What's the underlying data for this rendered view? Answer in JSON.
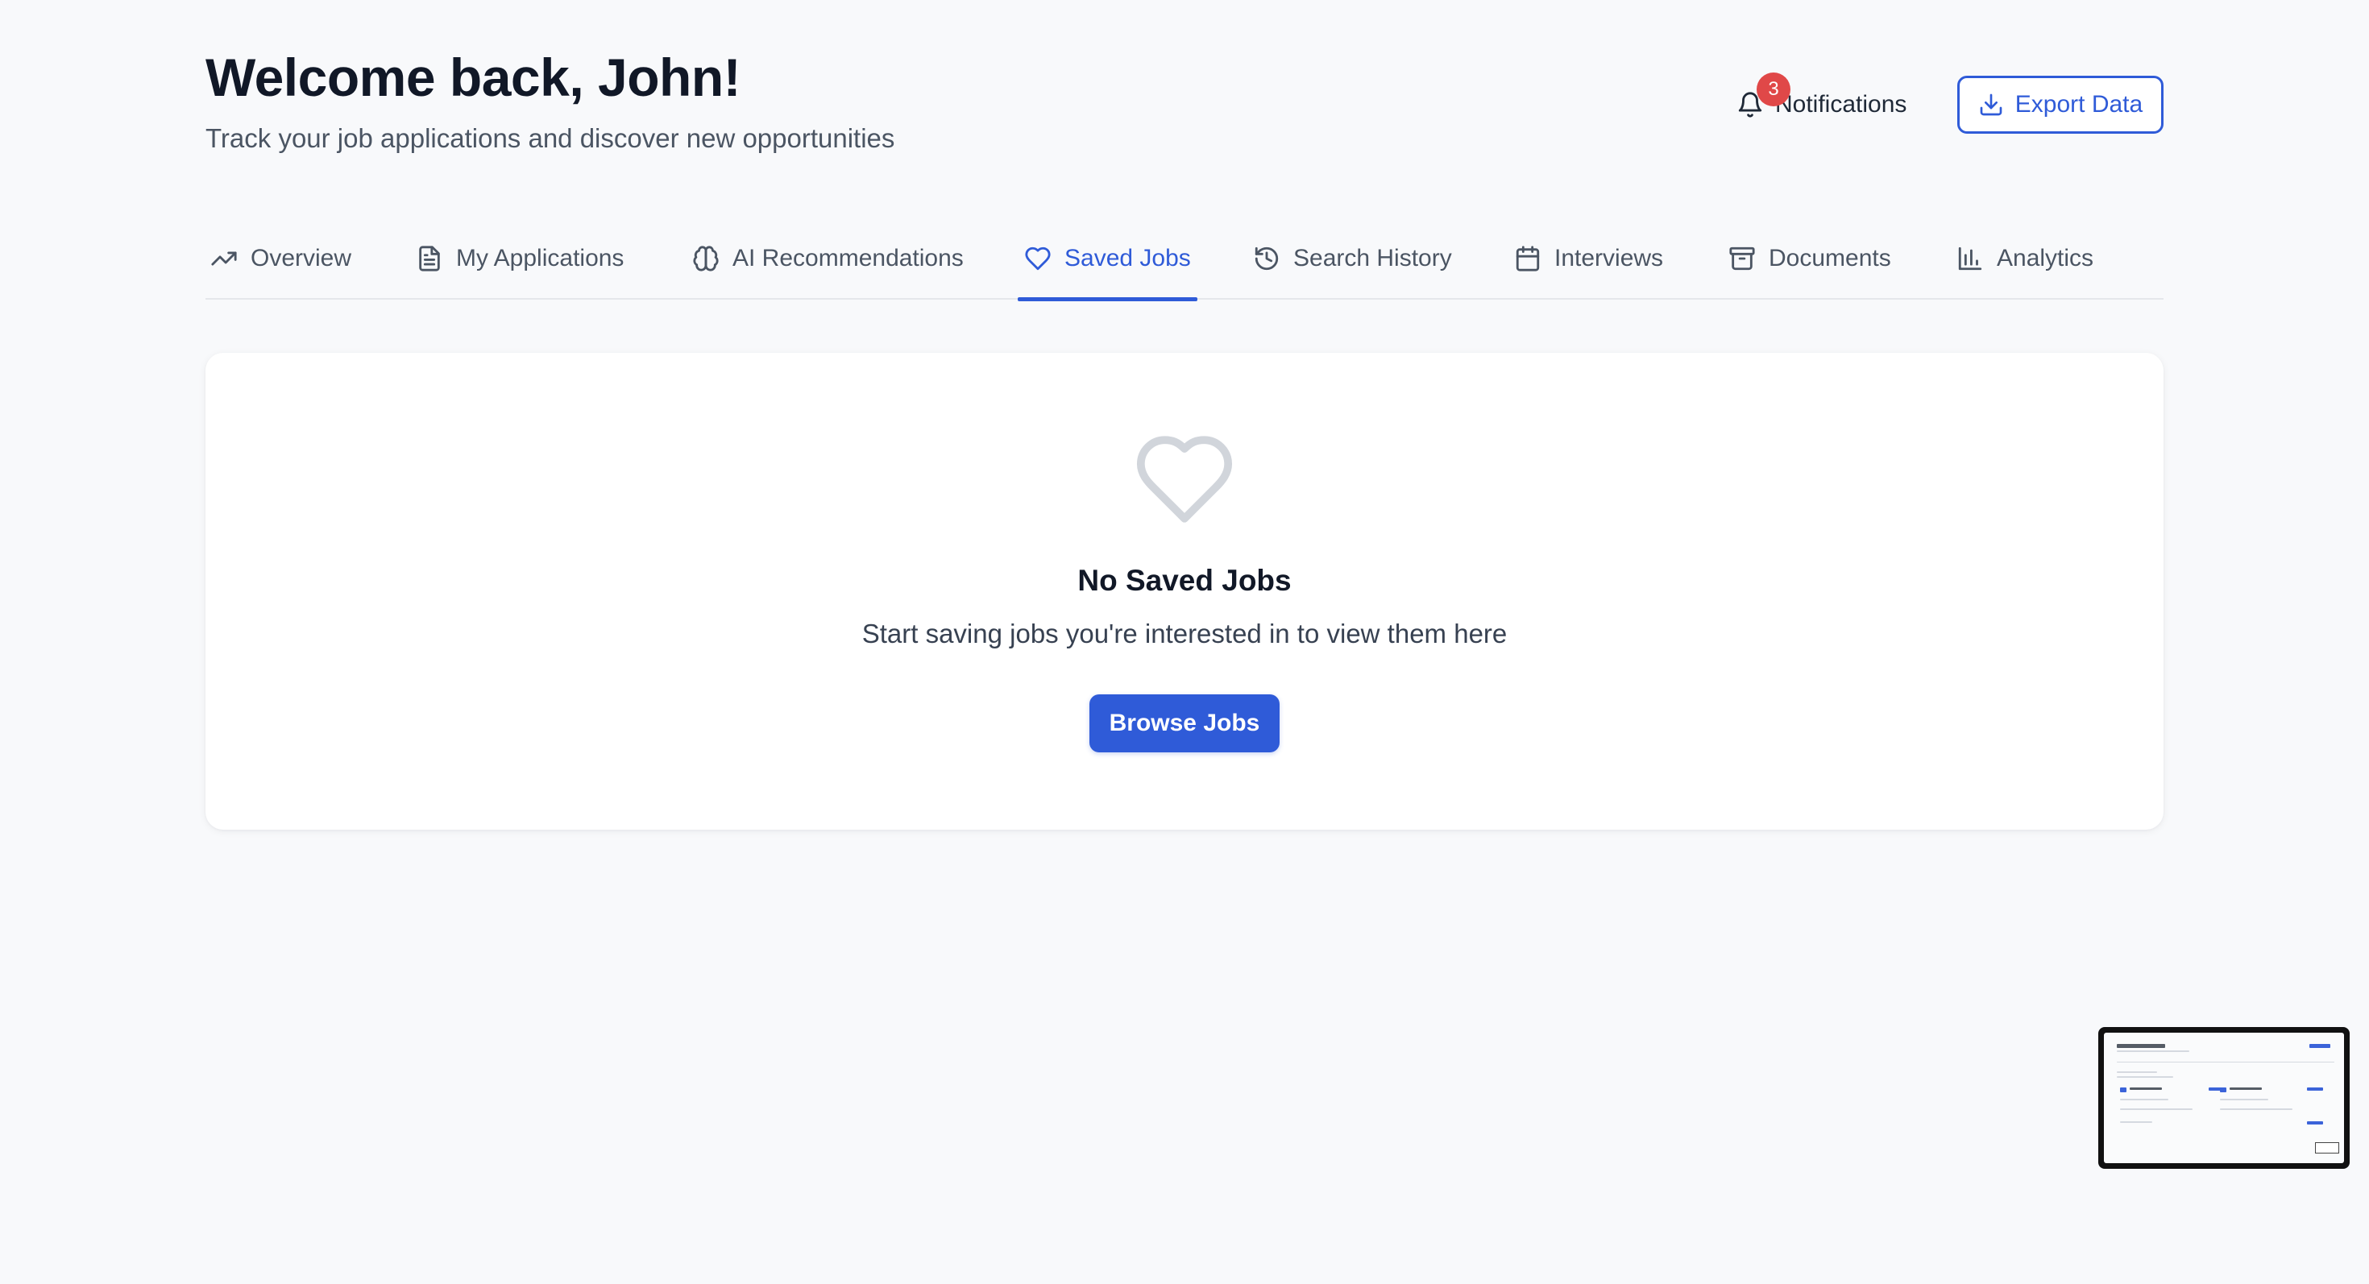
{
  "header": {
    "title": "Welcome back, John!",
    "subtitle": "Track your job applications and discover new opportunities",
    "notifications_label": "Notifications",
    "notifications_count": "3",
    "export_label": "Export Data"
  },
  "tabs": [
    {
      "label": "Overview",
      "icon": "trending-up-icon",
      "active": false
    },
    {
      "label": "My Applications",
      "icon": "file-text-icon",
      "active": false
    },
    {
      "label": "AI Recommendations",
      "icon": "brain-icon",
      "active": false
    },
    {
      "label": "Saved Jobs",
      "icon": "heart-icon",
      "active": true
    },
    {
      "label": "Search History",
      "icon": "history-icon",
      "active": false
    },
    {
      "label": "Interviews",
      "icon": "calendar-icon",
      "active": false
    },
    {
      "label": "Documents",
      "icon": "archive-icon",
      "active": false
    },
    {
      "label": "Analytics",
      "icon": "bar-chart-icon",
      "active": false
    }
  ],
  "empty_state": {
    "icon": "heart-outline-icon",
    "title": "No Saved Jobs",
    "description": "Start saving jobs you're interested in to view them here",
    "button_label": "Browse Jobs"
  },
  "colors": {
    "accent": "#2f5bd8",
    "badge": "#e04848",
    "background": "#f8f9fb"
  }
}
